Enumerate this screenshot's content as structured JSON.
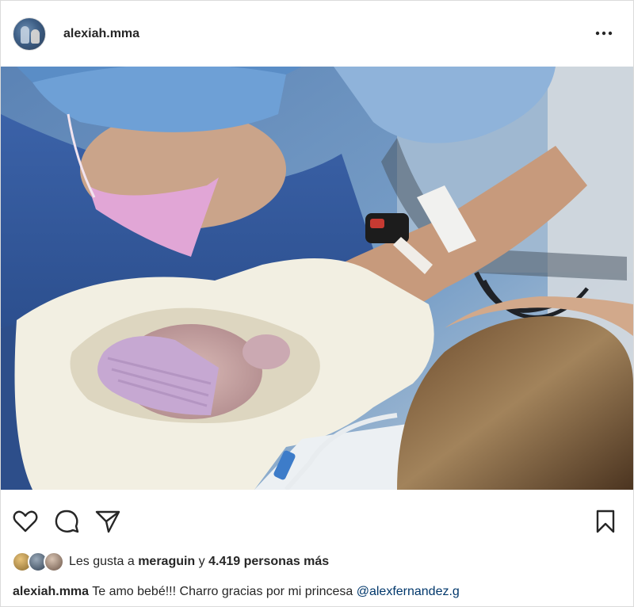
{
  "post": {
    "username": "alexiah.mma",
    "menu_icon": "more-horizontal-icon"
  },
  "actions": {
    "like_icon": "heart-icon",
    "comment_icon": "comment-icon",
    "share_icon": "paper-plane-icon",
    "save_icon": "bookmark-icon"
  },
  "likes": {
    "prefix": "Les gusta a",
    "first_user": "meraguin",
    "connector": "y",
    "count_text": "4.419 personas más"
  },
  "caption": {
    "username": "alexiah.mma",
    "text": "Te amo bebé!!! Charro gracias por mi princesa",
    "mention": "@alexfernandez.g"
  }
}
